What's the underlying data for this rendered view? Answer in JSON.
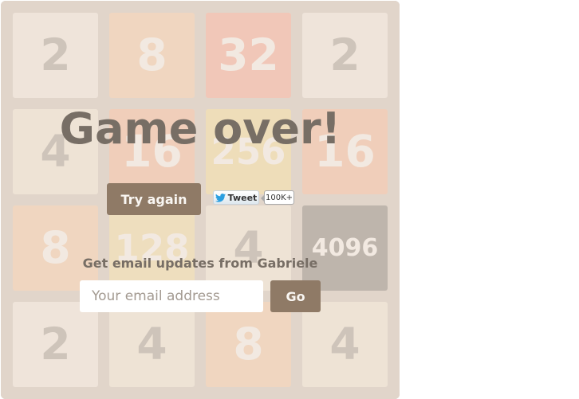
{
  "board": {
    "rows": [
      [
        "2",
        "8",
        "32",
        "2"
      ],
      [
        "4",
        "16",
        "256",
        "16"
      ],
      [
        "8",
        "128",
        "4",
        "4096"
      ],
      [
        "2",
        "4",
        "8",
        "4"
      ]
    ]
  },
  "overlay": {
    "title": "Game over!",
    "try_again_label": "Try again",
    "tweet_label": "Tweet",
    "tweet_count": "100K+"
  },
  "email": {
    "heading": "Get email updates from Gabriele",
    "placeholder": "Your email address",
    "go_label": "Go"
  },
  "colors": {
    "board_bg": "#bbada0",
    "button_bg": "#8f7a66",
    "text": "#776e65"
  },
  "icons": {
    "twitter": "twitter-bird-icon"
  }
}
